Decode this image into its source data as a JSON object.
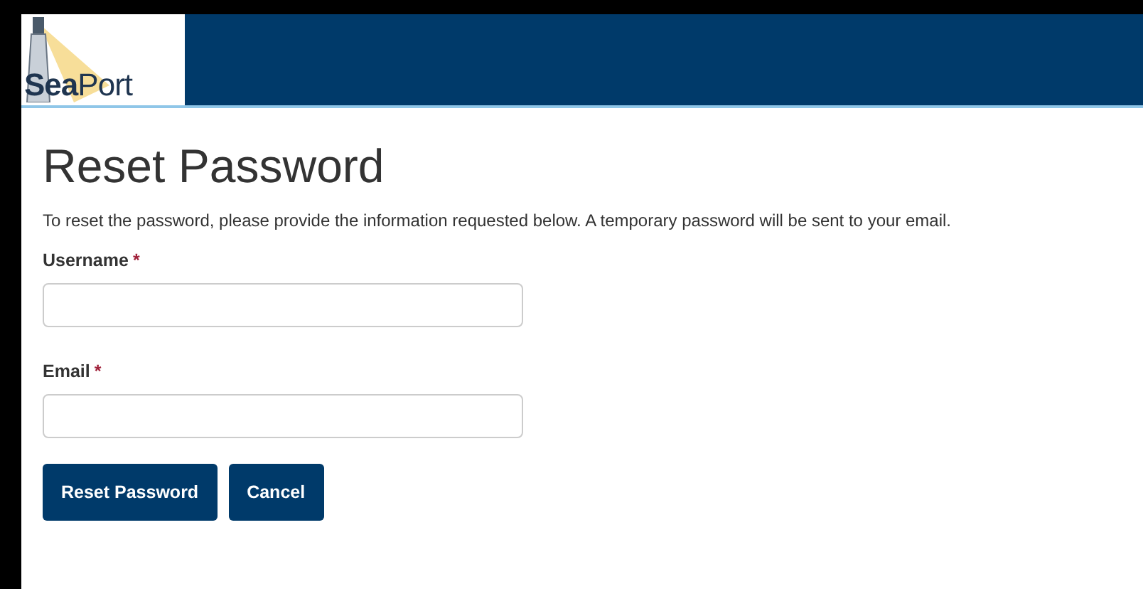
{
  "header": {
    "logo": "**Sea**Port"
  },
  "title": "Reset Password",
  "intro": "To reset the password, please provide the information requested below. A temporary password will be sent to your email.",
  "fields": [
    {
      "label": "Username",
      "required_mark": "*"
    },
    {
      "label": "Email",
      "required_mark": "*"
    }
  ],
  "buttons": [
    "Reset Password",
    "Cancel"
  ]
}
